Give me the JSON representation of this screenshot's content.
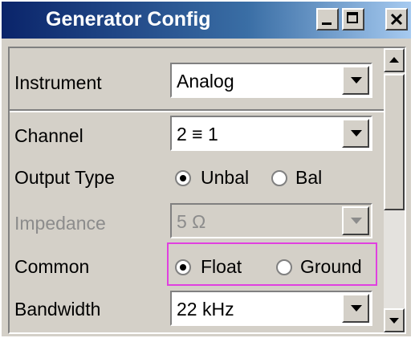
{
  "window": {
    "title": "Generator Config",
    "controls": [
      "minimize-icon",
      "maximize-icon",
      "close-icon"
    ]
  },
  "fields": {
    "instrument": {
      "label": "Instrument",
      "value": "Analog"
    },
    "channel": {
      "label": "Channel",
      "value": "2 ≡ 1"
    },
    "output_type": {
      "label": "Output Type",
      "options": [
        "Unbal",
        "Bal"
      ],
      "selected": "Unbal"
    },
    "impedance": {
      "label": "Impedance",
      "value": "5 Ω",
      "disabled": true
    },
    "common": {
      "label": "Common",
      "options": [
        "Float",
        "Ground"
      ],
      "selected": "Float"
    },
    "bandwidth": {
      "label": "Bandwidth",
      "value": "22 kHz"
    }
  },
  "colors": {
    "titlebar_start": "#0a246a",
    "titlebar_end": "#a6caf0",
    "highlight": "#e040e0",
    "panel": "#d4d0c8"
  }
}
